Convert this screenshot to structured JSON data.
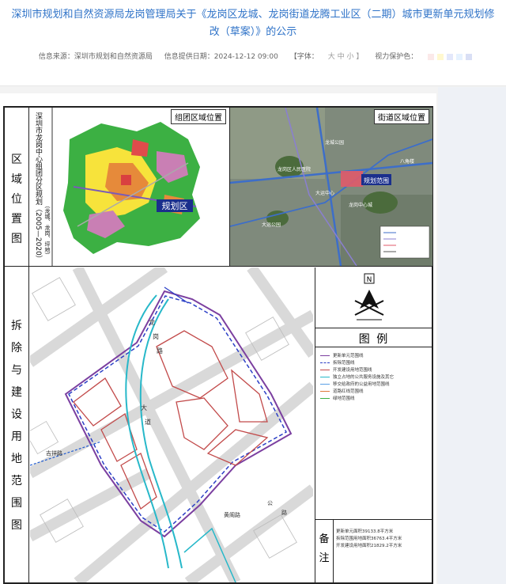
{
  "header": {
    "title": "深圳市规划和自然资源局龙岗管理局关于《龙岗区龙城、龙岗街道龙腾工业区（二期）城市更新单元规划修改（草案）》的公示",
    "source": "信息来源：深圳市规划和自然资源局",
    "date": "信息提供日期：2024-12-12 09:00",
    "font_label": "【字体：",
    "font_sizes": "大 中 小 】",
    "eye_label": "视力保护色：",
    "eye_colors": [
      "#fbe9e9",
      "#fff8cf",
      "#e3e8fb",
      "#e6f2ff",
      "#d9dff5"
    ]
  },
  "map": {
    "left_labels": [
      "区",
      "域",
      "位",
      "置",
      "图"
    ],
    "left_labels2": [
      "拆",
      "除",
      "与",
      "建",
      "设",
      "用",
      "地",
      "范",
      "围",
      "图"
    ],
    "note_chars": [
      "备",
      "注"
    ],
    "map1_label": "组团区域位置",
    "map1_vertical": "深圳市龙岗中心组团分区规划（2005—2020）",
    "map1_vertical2": "（龙城、龙岗、坪地）",
    "map1_tag": "规划区",
    "map2_label": "街道区域位置",
    "map2_tag": "规划范围",
    "map2_places": [
      "龙城公园",
      "大运中心",
      "龙岗中心城",
      "八角楼",
      "大运公园",
      "龙岗区人民医院"
    ],
    "legend_title": "图   例",
    "legend_items": [
      "更新单元范围线",
      "拆除范围线",
      "开发建设用地范围线",
      "独立占地的公共服务设施及其它",
      "移交给政府的公益用地范围线",
      "道路红线范围线",
      "绿地范围线"
    ],
    "north": "N",
    "notes": [
      "更新单元面积39133.8平方米",
      "拆除范围用地面积36763.4平方米",
      "开发建设用地面积21829.2平方米"
    ],
    "street_labels": [
      "吉祥路",
      "龙",
      "岗",
      "路",
      "大",
      "道",
      "黄阁路",
      "公",
      "路"
    ]
  }
}
